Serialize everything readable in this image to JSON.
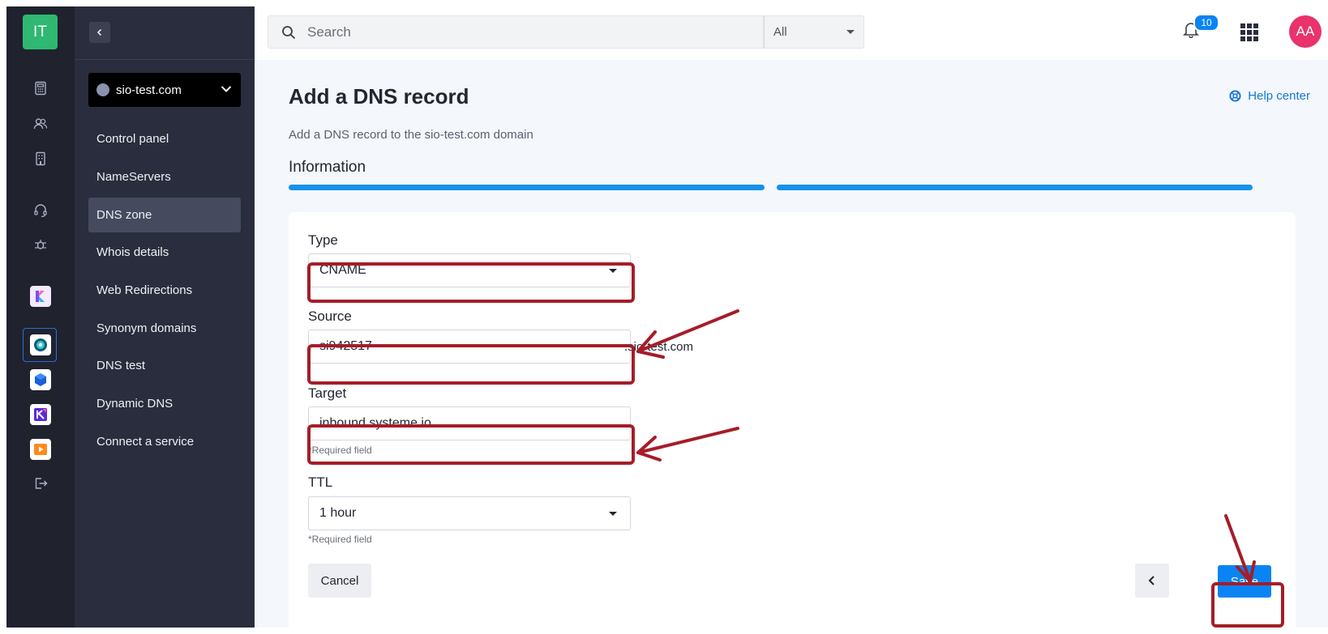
{
  "app": {
    "logo_text": "IT"
  },
  "rail": {
    "icons": [
      "calculator-icon",
      "users-icon",
      "building-icon",
      "headset-icon",
      "bug-icon"
    ],
    "apps": [
      {
        "name": "app-k",
        "color": "#e7e1ff"
      },
      {
        "name": "app-circle",
        "color": "#ffffff"
      },
      {
        "name": "app-cube",
        "color": "#ffffff"
      },
      {
        "name": "app-k2",
        "color": "#ffffff"
      },
      {
        "name": "app-play",
        "color": "#ffffff"
      }
    ],
    "logout_icon": "logout-icon"
  },
  "sidebar": {
    "domain": "sio-test.com",
    "items": [
      {
        "label": "Control panel"
      },
      {
        "label": "NameServers"
      },
      {
        "label": "DNS zone",
        "active": true
      },
      {
        "label": "Whois details"
      },
      {
        "label": "Web Redirections"
      },
      {
        "label": "Synonym domains"
      },
      {
        "label": "DNS test"
      },
      {
        "label": "Dynamic DNS"
      },
      {
        "label": "Connect a service"
      }
    ]
  },
  "topbar": {
    "search_placeholder": "Search",
    "scope": "All",
    "notifications": "10",
    "avatar": "AA"
  },
  "page": {
    "title": "Add a DNS record",
    "help": "Help center",
    "subtitle": "Add a DNS record to the sio-test.com domain",
    "step": "Information"
  },
  "form": {
    "type_label": "Type",
    "type_value": "CNAME",
    "source_label": "Source",
    "source_value": "si942517",
    "source_suffix": ".sio-test.com",
    "target_label": "Target",
    "target_value": "inbound.systeme.io.",
    "required": "*Required field",
    "ttl_label": "TTL",
    "ttl_value": "1 hour",
    "cancel": "Cancel",
    "save": "Save"
  },
  "colors": {
    "accent": "#0b84f3",
    "annotation": "#a51d28",
    "rail": "#20222e",
    "sidebar": "#2a2d3d"
  }
}
